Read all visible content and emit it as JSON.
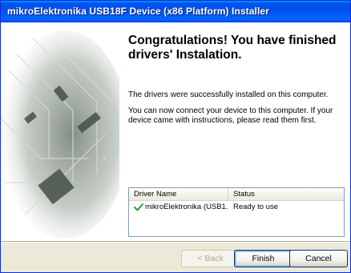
{
  "window": {
    "title": "mikroElektronika USB18F Device (x86 Platform) Installer"
  },
  "colors": {
    "titlebar": "#0050ee",
    "dialog_bg": "#ece9d8",
    "check": "#2f9a2f",
    "button_border": "#003c74"
  },
  "side_image": {
    "icon": "circuit-board-image"
  },
  "main": {
    "heading": "Congratulations! You have finished drivers' Instalation.",
    "paragraph1": "The drivers were successfully installed on this computer.",
    "paragraph2": "You can now connect your device to this computer. If your device came with instructions, please read them first."
  },
  "drivers_list": {
    "columns": [
      "Driver Name",
      "Status"
    ],
    "rows": [
      {
        "icon": "check-icon",
        "name": "mikroElektronika (USB1...",
        "status": "Ready to use"
      }
    ]
  },
  "buttons": {
    "back": "< Back",
    "finish": "Finish",
    "cancel": "Cancel"
  }
}
